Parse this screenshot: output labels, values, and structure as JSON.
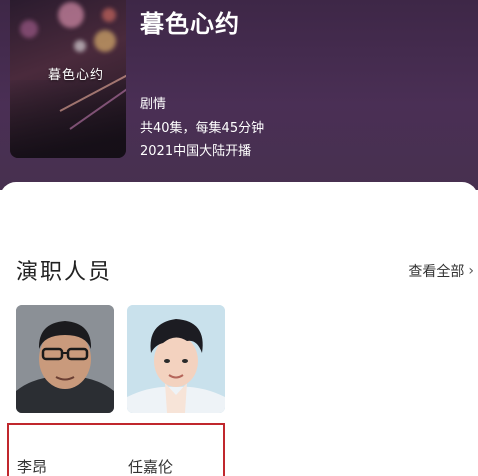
{
  "drama": {
    "title": "暮色心约",
    "poster_text": "暮色心约",
    "genre": "剧情",
    "episodes": "共40集，每集45分钟",
    "release": "2021中国大陆开播"
  },
  "cast_section": {
    "title": "演职人员",
    "view_all": "查看全部",
    "members": [
      {
        "name": "李昂"
      },
      {
        "name": "任嘉伦"
      }
    ]
  },
  "colors": {
    "header_bg": "#47304f",
    "highlight": "#c0272d"
  }
}
